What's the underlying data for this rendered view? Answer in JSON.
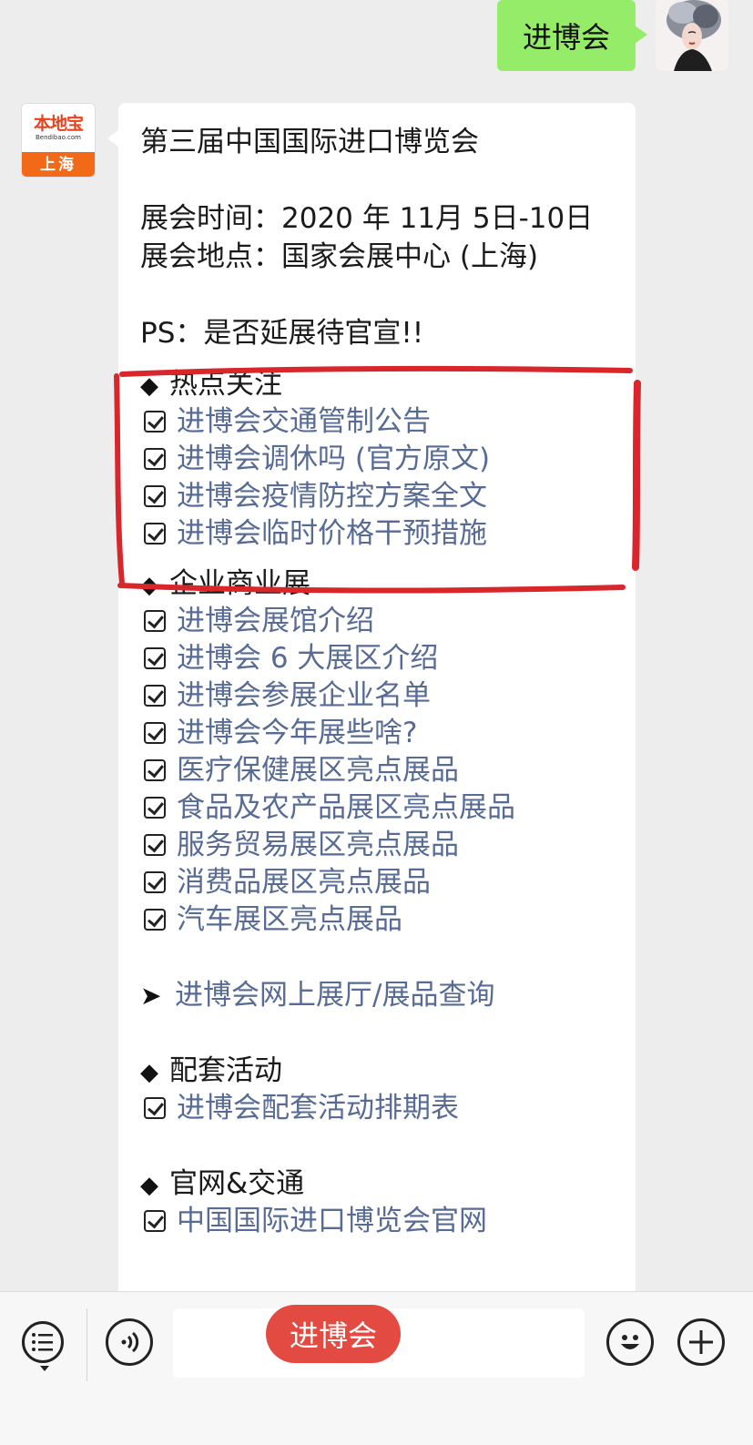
{
  "user_message": {
    "text": "进博会"
  },
  "bot_avatar": {
    "brand": "本地宝",
    "brand_sub": "Bendibao.com",
    "city": "上海"
  },
  "message": {
    "title": "第三届中国国际进口博览会",
    "time_label": "展会时间：",
    "time_value": "2020 年 11月 5日-10日",
    "place_label": "展会地点：",
    "place_value": "国家会展中心 (上海)",
    "ps": "PS：是否延展待官宣!!",
    "sections": {
      "hot": {
        "title": "热点关注",
        "items": [
          "进博会交通管制公告",
          "进博会调休吗 (官方原文)",
          "进博会疫情防控方案全文",
          "进博会临时价格干预措施"
        ]
      },
      "business": {
        "title": "企业商业展",
        "items": [
          "进博会展馆介绍",
          "进博会 6 大展区介绍",
          "进博会参展企业名单",
          "进博会今年展些啥?",
          "医疗保健展区亮点展品",
          "食品及农产品展区亮点展品",
          "服务贸易展区亮点展品",
          "消费品展区亮点展品",
          "汽车展区亮点展品"
        ]
      },
      "online": {
        "link": "进博会网上展厅/展品查询"
      },
      "activities": {
        "title": "配套活动",
        "items": [
          "进博会配套活动排期表"
        ]
      },
      "official": {
        "title": "官网&交通",
        "items": [
          "中国国际进口博览会官网"
        ]
      }
    }
  },
  "input_bar": {
    "quick_reply": "进博会"
  },
  "colors": {
    "link": "#576b95",
    "user_bubble": "#95ec69",
    "highlight": "#d8262c",
    "pill": "#e34a42"
  }
}
